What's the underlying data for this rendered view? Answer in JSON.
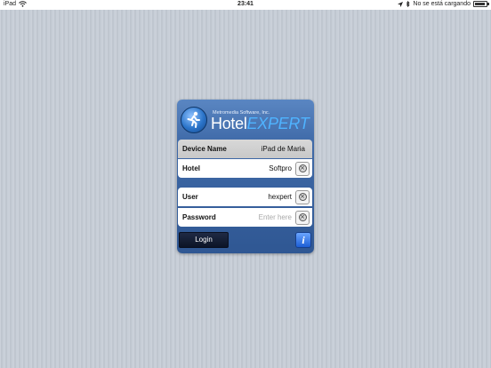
{
  "status_bar": {
    "device": "iPad",
    "wifi_icon": "wifi-icon",
    "time": "23:41",
    "location_icon": "location-arrow-icon",
    "bluetooth_icon": "bluetooth-icon",
    "charging_status": "No se está cargando",
    "battery_level": 0.9
  },
  "login": {
    "brand_subtitle": "Metromedia Software, Inc.",
    "brand_name": "Hotel",
    "brand_accent": "EXPERT",
    "logo_icon": "running-man-icon",
    "device_label": "Device Name",
    "device_value": "iPad de Maria",
    "hotel_label": "Hotel",
    "hotel_value": "Softpro",
    "user_label": "User",
    "user_value": "hexpert",
    "password_label": "Password",
    "password_placeholder": "Enter here",
    "login_button": "Login",
    "info_button": "i",
    "clear_icon": "clear-x-icon"
  },
  "colors": {
    "background": "#c5ccd6",
    "panel": "#3f6aa8",
    "accent": "#4fb3ff"
  }
}
